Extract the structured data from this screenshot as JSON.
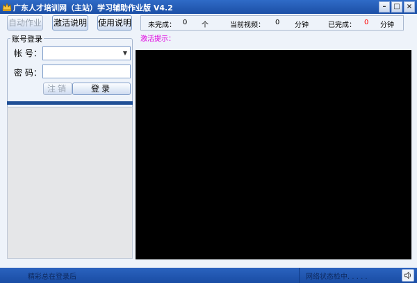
{
  "window": {
    "title": "广东人才培训网（主站）学习辅助作业版 V4.2",
    "minimize_glyph": "–",
    "maximize_glyph": "□",
    "close_glyph": "×"
  },
  "toolbar": {
    "auto_label": "自动作业",
    "activate_label": "激活说明",
    "usage_label": "使用说明"
  },
  "stats": {
    "incomplete_label": "未完成：",
    "incomplete_value": "0",
    "incomplete_unit": "个",
    "current_video_label": "当前视频：",
    "current_video_value": "0",
    "current_video_unit": "分钟",
    "completed_label": "已完成：",
    "completed_value": "0",
    "completed_unit": "分钟",
    "completed_value_color": "#ff0000"
  },
  "activation_hint": "激活提示：",
  "login": {
    "legend": "账号登录",
    "account_label": "帐   号：",
    "account_value": "",
    "password_label": "密   码：",
    "password_value": "",
    "cancel_label": "注销",
    "login_label": "登录"
  },
  "progress": {
    "fraction": 1.0
  },
  "status": {
    "left_text": "精彩总在登录后",
    "right_text": "网络状态检中. . . . ."
  },
  "icons": {
    "app": "crown-icon",
    "speaker": "speaker-icon"
  }
}
